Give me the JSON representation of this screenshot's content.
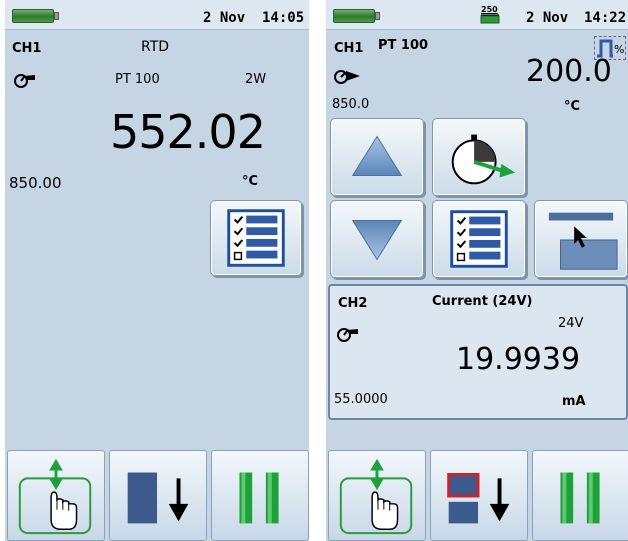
{
  "left": {
    "date": "2 Nov",
    "time": "14:05",
    "channel": "CH1",
    "function": "RTD",
    "sensor": "PT 100",
    "wires": "2W",
    "reading": "552.02",
    "range": "850.00",
    "unit": "°C"
  },
  "right": {
    "date": "2 Nov",
    "time": "14:22",
    "status_icon_text": "250",
    "percent_symbol": "%",
    "ch1": {
      "channel": "CH1",
      "sensor": "PT 100",
      "value": "200.0",
      "range": "850.0",
      "unit": "°C"
    },
    "ch2": {
      "channel": "CH2",
      "function": "Current (24V)",
      "supply": "24V",
      "reading": "19.9939",
      "range": "55.0000",
      "unit": "mA"
    }
  },
  "icons": {
    "measure": "measure-gauge-icon",
    "source": "source-arrow-icon",
    "menu": "checklist-menu-icon",
    "step_up": "triangle-up-icon",
    "step_down": "triangle-down-icon",
    "ramp": "stopwatch-ramp-icon",
    "set_value": "cursor-set-value-icon",
    "switch_channel": "hand-up-down-icon",
    "hold": "bar-down-arrow-icon",
    "pause": "pause-icon",
    "percent_step": "percent-step-icon"
  },
  "colors": {
    "screen": "#c5d5e4",
    "status_green": "#2f7a2f",
    "icon_blue": "#2f5aa8",
    "pause_green": "#1fa13a",
    "highlight_red": "#c8242c"
  }
}
